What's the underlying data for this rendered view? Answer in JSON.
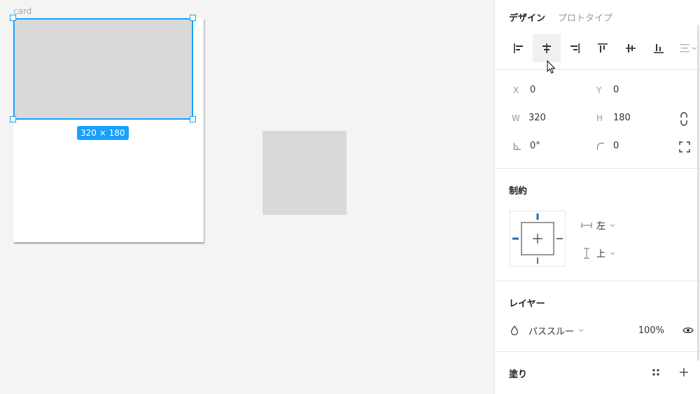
{
  "canvas": {
    "frame_label": "card",
    "size_badge": "320 × 180"
  },
  "panel": {
    "tabs": [
      {
        "label": "デザイン",
        "active": true
      },
      {
        "label": "プロトタイプ",
        "active": false
      }
    ],
    "align_tools": [
      {
        "icon": "align-left-icon"
      },
      {
        "icon": "align-horizontal-center-icon"
      },
      {
        "icon": "align-right-icon"
      },
      {
        "icon": "align-top-icon"
      },
      {
        "icon": "align-vertical-center-icon"
      },
      {
        "icon": "align-bottom-icon"
      },
      {
        "icon": "distribute-icon"
      }
    ],
    "position": {
      "x_label": "X",
      "x_value": "0",
      "y_label": "Y",
      "y_value": "0",
      "w_label": "W",
      "w_value": "320",
      "h_label": "H",
      "h_value": "180",
      "rotation_value": "0°",
      "radius_value": "0"
    },
    "constraints": {
      "title": "制約",
      "horizontal": "左",
      "vertical": "上"
    },
    "layer": {
      "title": "レイヤー",
      "blend_mode": "パススルー",
      "opacity": "100%"
    },
    "fill": {
      "title": "塗り"
    }
  },
  "colors": {
    "selection": "#18a0fb",
    "placeholder_fill": "#d9d9d9",
    "canvas_bg": "#f4f4f4",
    "constraint_active": "#1b6fb5"
  }
}
